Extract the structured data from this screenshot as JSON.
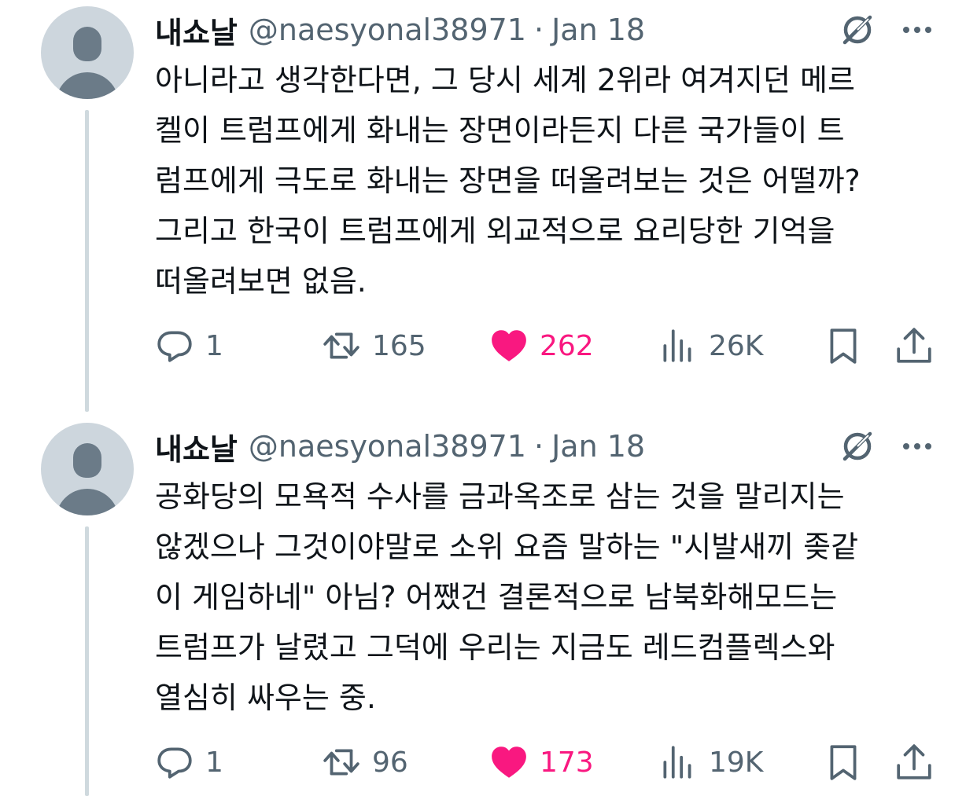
{
  "tweets": [
    {
      "author_name": "내쇼날",
      "handle": "@naesyonal38971",
      "separator": "·",
      "date": "Jan 18",
      "body_lines": [
        "아니라고 생각한다면, 그 당시 세계 2위라 여겨지던 메르",
        "켈이 트럼프에게 화내는 장면이라든지 다른 국가들이 트",
        "럼프에게 극도로 화내는 장면을 떠올려보는 것은 어떨까?",
        "그리고 한국이 트럼프에게 외교적으로 요리당한 기억을",
        "떠올려보면 없음."
      ],
      "replies": "1",
      "reposts": "165",
      "likes": "262",
      "views": "26K"
    },
    {
      "author_name": "내쇼날",
      "handle": "@naesyonal38971",
      "separator": "·",
      "date": "Jan 18",
      "body_lines": [
        "공화당의 모욕적 수사를 금과옥조로 삼는 것을 말리지는",
        "않겠으나 그것이야말로 소위 요즘 말하는 \"시발새끼 좆같",
        "이 게임하네\" 아님? 어쨌건 결론적으로 남북화해모드는",
        "트럼프가 날렸고 그덕에 우리는 지금도 레드컴플렉스와",
        "열심히 싸우는 중."
      ],
      "replies": "1",
      "reposts": "96",
      "likes": "173",
      "views": "19K"
    }
  ],
  "colors": {
    "text_primary": "#0f1419",
    "text_secondary": "#536471",
    "like_active": "#f91880",
    "avatar_bg": "#cdd6dd",
    "avatar_fg": "#6b7b88",
    "thread_line": "#cfd9de"
  },
  "icons": {
    "grok": "grok-icon",
    "more": "more-icon",
    "reply": "reply-icon",
    "repost": "repost-icon",
    "like": "heart-filled-icon",
    "views": "views-icon",
    "bookmark": "bookmark-icon",
    "share": "share-icon"
  }
}
